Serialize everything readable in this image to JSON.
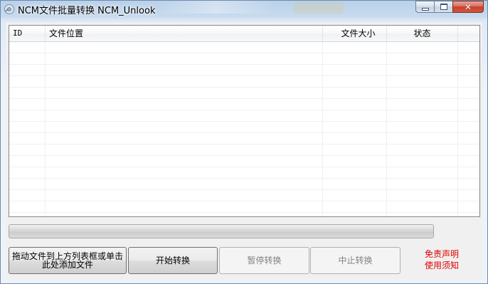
{
  "window": {
    "title": "NCM文件批量转换 NCM_Unlook",
    "controls": {
      "close_symbol": "✕"
    }
  },
  "file_list": {
    "columns": [
      {
        "key": "id",
        "label": "ID"
      },
      {
        "key": "path",
        "label": "文件位置"
      },
      {
        "key": "size",
        "label": "文件大小"
      },
      {
        "key": "status",
        "label": "状态"
      }
    ],
    "rows": []
  },
  "progress": {
    "value": 0
  },
  "buttons": {
    "add_files": "拖动文件到上方列表框或单击此处添加文件",
    "start": "开始转换",
    "pause": "暂停转换",
    "stop": "中止转换"
  },
  "links": {
    "disclaimer": "免责声明",
    "usage_notice": "使用须知"
  },
  "colors": {
    "link_red": "#e00000",
    "progress_green": "#26b128"
  },
  "icons": {
    "app": "app-icon",
    "minimize": "minimize-icon",
    "maximize": "maximize-icon",
    "close": "close-icon"
  }
}
